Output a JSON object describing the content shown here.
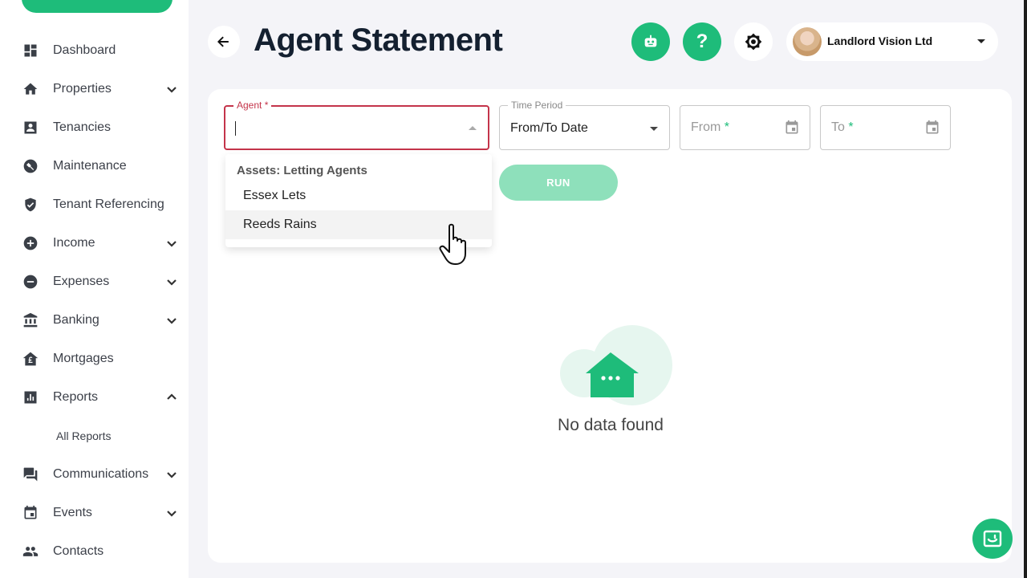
{
  "sidebar": {
    "items": [
      {
        "label": "Dashboard",
        "icon": "dashboard-icon",
        "chevron": ""
      },
      {
        "label": "Properties",
        "icon": "home-icon",
        "chevron": "down"
      },
      {
        "label": "Tenancies",
        "icon": "person-card-icon",
        "chevron": ""
      },
      {
        "label": "Maintenance",
        "icon": "wrench-icon",
        "chevron": ""
      },
      {
        "label": "Tenant Referencing",
        "icon": "shield-check-icon",
        "chevron": ""
      },
      {
        "label": "Income",
        "icon": "plus-circle-icon",
        "chevron": "down"
      },
      {
        "label": "Expenses",
        "icon": "minus-circle-icon",
        "chevron": "down"
      },
      {
        "label": "Banking",
        "icon": "bank-icon",
        "chevron": "down"
      },
      {
        "label": "Mortgages",
        "icon": "pound-house-icon",
        "chevron": ""
      },
      {
        "label": "Reports",
        "icon": "bar-chart-icon",
        "chevron": "up"
      },
      {
        "label": "Communications",
        "icon": "chat-icon",
        "chevron": "down"
      },
      {
        "label": "Events",
        "icon": "calendar-icon",
        "chevron": "down"
      },
      {
        "label": "Contacts",
        "icon": "people-icon",
        "chevron": ""
      }
    ],
    "reports_sub": "All Reports"
  },
  "header": {
    "title": "Agent Statement",
    "account_name": "Landlord Vision Ltd"
  },
  "form": {
    "agent_label": "Agent *",
    "time_period_label": "Time Period",
    "time_period_value": "From/To Date",
    "from_placeholder": "From",
    "to_placeholder": "To",
    "required_mark": "*",
    "run_label": "RUN"
  },
  "dropdown": {
    "group": "Assets: Letting Agents",
    "options": [
      "Essex Lets",
      "Reeds Rains"
    ]
  },
  "empty_state": {
    "text": "No data found"
  },
  "colors": {
    "accent": "#1ebc7a",
    "error": "#c4344a",
    "title": "#142030"
  }
}
